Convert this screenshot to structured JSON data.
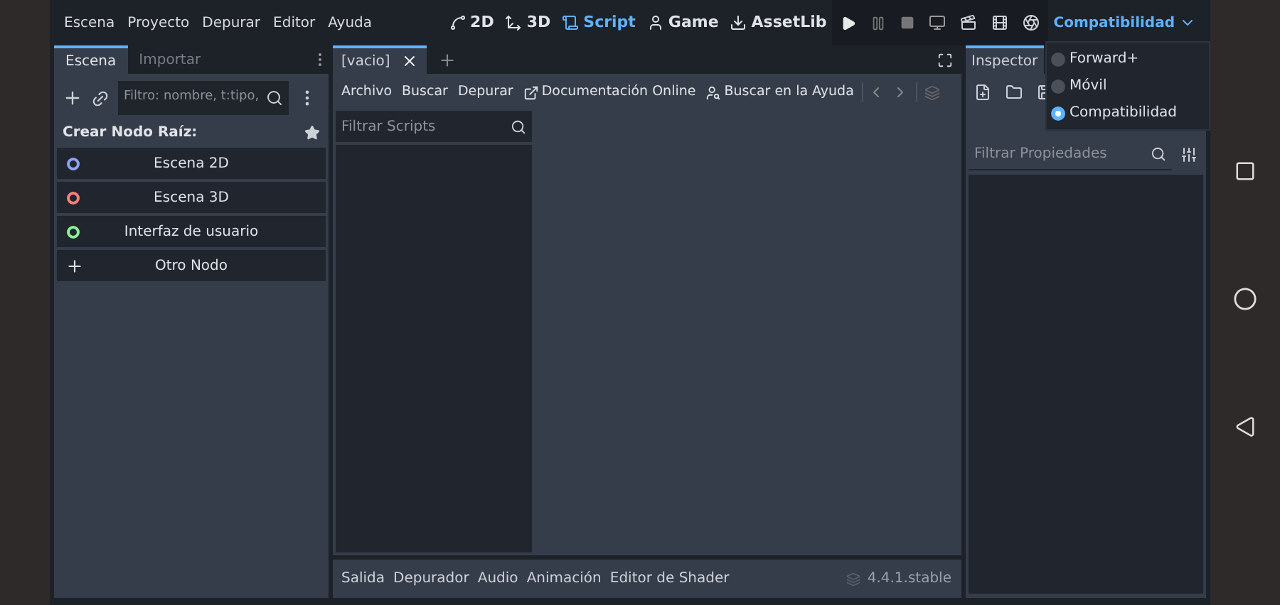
{
  "menu": [
    "Escena",
    "Proyecto",
    "Depurar",
    "Editor",
    "Ayuda"
  ],
  "workspaces": [
    {
      "label": "2D",
      "kind": "canvas",
      "selected": false
    },
    {
      "label": "3D",
      "kind": "spatial",
      "selected": false
    },
    {
      "label": "Script",
      "kind": "script",
      "selected": true
    },
    {
      "label": "Game",
      "kind": "game",
      "selected": false
    },
    {
      "label": "AssetLib",
      "kind": "assetlib",
      "selected": false
    }
  ],
  "renderer": {
    "label": "Compatibilidad",
    "expanded": true,
    "options": [
      {
        "label": "Forward+",
        "selected": false
      },
      {
        "label": "Móvil",
        "selected": false
      },
      {
        "label": "Compatibilidad",
        "selected": true
      }
    ]
  },
  "scene_dock": {
    "tabs": [
      {
        "label": "Escena",
        "selected": true
      },
      {
        "label": "Importar",
        "selected": false
      }
    ],
    "filter": {
      "placeholder": "Filtro: nombre, t:tipo,"
    },
    "heading": "Crear Nodo Raíz:",
    "nodes": [
      {
        "label": "Escena 2D",
        "kind": "circle",
        "color": "#8da5f3"
      },
      {
        "label": "Escena 3D",
        "kind": "circle",
        "color": "#fc7f7f"
      },
      {
        "label": "Interfaz de usuario",
        "kind": "circle",
        "color": "#8eef97"
      },
      {
        "label": "Otro Nodo",
        "kind": "plus"
      }
    ]
  },
  "script_editor": {
    "tabs": [
      {
        "label": "[vacio]",
        "selected": true
      }
    ],
    "menu": [
      {
        "label": "Archivo",
        "kind": "text"
      },
      {
        "label": "Buscar",
        "kind": "text"
      },
      {
        "label": "Depurar",
        "kind": "text"
      },
      {
        "label": "Documentación Online",
        "kind": "docs"
      },
      {
        "label": "Buscar en la Ayuda",
        "kind": "help"
      }
    ],
    "filter": {
      "placeholder": "Filtrar Scripts"
    }
  },
  "bottom_panel": {
    "tabs": [
      "Salida",
      "Depurador",
      "Audio",
      "Animación",
      "Editor de Shader"
    ],
    "version": "4.4.1.stable"
  },
  "inspector": {
    "tab": "Inspector",
    "filter": {
      "placeholder": "Filtrar Propiedades"
    }
  }
}
